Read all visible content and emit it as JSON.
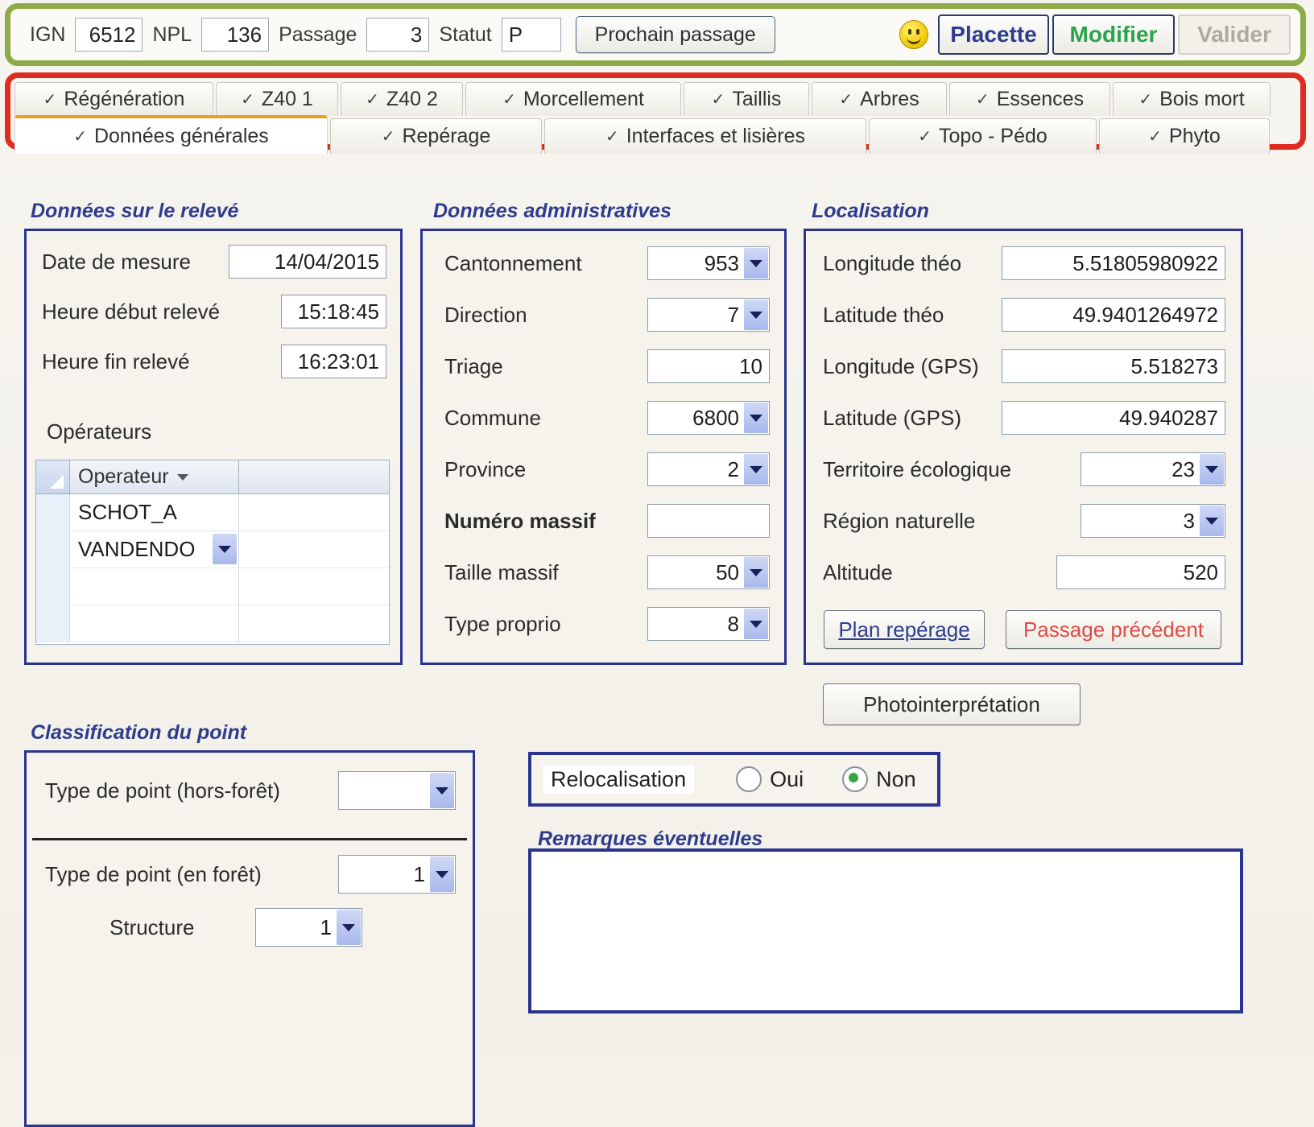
{
  "header": {
    "ign_label": "IGN",
    "ign_value": "6512",
    "npl_label": "NPL",
    "npl_value": "136",
    "passage_label": "Passage",
    "passage_value": "3",
    "statut_label": "Statut",
    "statut_value": "P",
    "next_passage_button": "Prochain passage",
    "smiley_icon": "smiley-face-icon",
    "placette_button": "Placette",
    "modifier_button": "Modifier",
    "valider_button": "Valider",
    "border_color": "#8faa49"
  },
  "tabs": {
    "border_color": "#e02b20",
    "active_indicator_color": "#e8a020",
    "check_glyph": "✓",
    "row1": [
      {
        "label": "Régénération",
        "active": false
      },
      {
        "label": "Z40 1",
        "active": false
      },
      {
        "label": "Z40 2",
        "active": false
      },
      {
        "label": "Morcellement",
        "active": false
      },
      {
        "label": "Taillis",
        "active": false
      },
      {
        "label": "Arbres",
        "active": false
      },
      {
        "label": "Essences",
        "active": false
      },
      {
        "label": "Bois mort",
        "active": false
      }
    ],
    "row2": [
      {
        "label": "Données générales",
        "active": true
      },
      {
        "label": "Repérage",
        "active": false
      },
      {
        "label": "Interfaces et lisières",
        "active": false
      },
      {
        "label": "Topo - Pédo",
        "active": false
      },
      {
        "label": "Phyto",
        "active": false
      }
    ]
  },
  "releve": {
    "title": "Données sur le relevé",
    "fields": [
      {
        "label": "Date de mesure",
        "value": "14/04/2015"
      },
      {
        "label": "Heure début relevé",
        "value": "15:18:45"
      },
      {
        "label": "Heure fin relevé",
        "value": "16:23:01"
      }
    ],
    "operators_label": "Opérateurs",
    "grid": {
      "column_header": "Operateur",
      "rows": [
        "SCHOT_A",
        "VANDENDO"
      ]
    }
  },
  "administratives": {
    "title": "Données administratives",
    "fields": [
      {
        "label": "Cantonnement",
        "value": "953",
        "combo": true,
        "bold": false
      },
      {
        "label": "Direction",
        "value": "7",
        "combo": true,
        "bold": false
      },
      {
        "label": "Triage",
        "value": "10",
        "combo": false,
        "bold": false
      },
      {
        "label": "Commune",
        "value": "6800",
        "combo": true,
        "bold": false
      },
      {
        "label": "Province",
        "value": "2",
        "combo": true,
        "bold": false
      },
      {
        "label": "Numéro massif",
        "value": "",
        "combo": false,
        "bold": true
      },
      {
        "label": "Taille massif",
        "value": "50",
        "combo": true,
        "bold": false
      },
      {
        "label": "Type proprio",
        "value": "8",
        "combo": true,
        "bold": false
      }
    ]
  },
  "localisation": {
    "title": "Localisation",
    "fields": [
      {
        "label": "Longitude théo",
        "value": "5.51805980922",
        "combo": false,
        "wide": true
      },
      {
        "label": "Latitude théo",
        "value": "49.9401264972",
        "combo": false,
        "wide": true
      },
      {
        "label": "Longitude (GPS)",
        "value": "5.518273",
        "combo": false,
        "wide": true
      },
      {
        "label": "Latitude (GPS)",
        "value": "49.940287",
        "combo": false,
        "wide": true
      },
      {
        "label": "Territoire écologique",
        "value": "23",
        "combo": true,
        "wide": false
      },
      {
        "label": "Région naturelle",
        "value": "3",
        "combo": true,
        "wide": false
      },
      {
        "label": "Altitude",
        "value": "520",
        "combo": false,
        "wide": false
      }
    ],
    "plan_button": "Plan repérage",
    "previous_button": "Passage précédent"
  },
  "photo_button": "Photointerprétation",
  "classification": {
    "title": "Classification du point",
    "hors_foret_label": "Type de point (hors-forêt)",
    "hors_foret_value": "",
    "en_foret_label": "Type de point (en forêt)",
    "en_foret_value": "1",
    "structure_label": "Structure",
    "structure_value": "1"
  },
  "relocalisation": {
    "label": "Relocalisation",
    "yes_label": "Oui",
    "no_label": "Non",
    "selected": "Non",
    "selected_color": "#35a845"
  },
  "remarques": {
    "title": "Remarques éventuelles",
    "value": "",
    "placeholder": ""
  }
}
